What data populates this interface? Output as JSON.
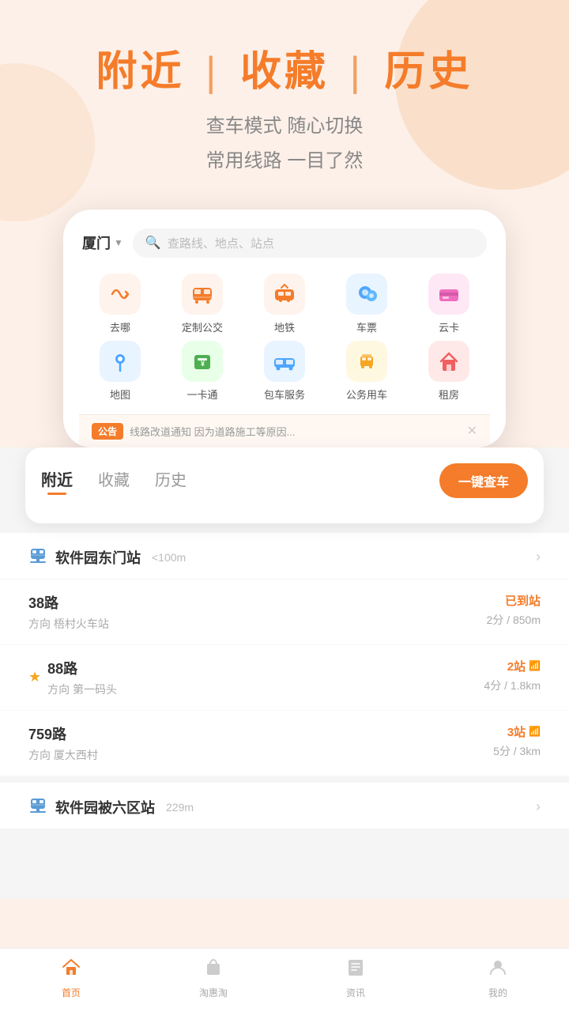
{
  "hero": {
    "title_part1": "附近",
    "title_divider": "|",
    "title_part2": "收藏",
    "title_divider2": "|",
    "title_part3": "历史",
    "subtitle_line1": "查车模式 随心切换",
    "subtitle_line2": "常用线路 一目了然"
  },
  "app": {
    "city": "厦门",
    "search_placeholder": "查路线、地点、站点"
  },
  "icon_grid": {
    "row1": [
      {
        "label": "去哪",
        "icon": "🔄",
        "bg": "#fff3ed",
        "color": "#f47c2a"
      },
      {
        "label": "定制公交",
        "icon": "🚌",
        "bg": "#fff3ed",
        "color": "#f47c2a"
      },
      {
        "label": "地铁",
        "icon": "🚇",
        "bg": "#fff3ed",
        "color": "#f47c2a"
      },
      {
        "label": "车票",
        "icon": "👥",
        "bg": "#e8f4ff",
        "color": "#4da6ff"
      },
      {
        "label": "云卡",
        "icon": "💳",
        "bg": "#ffe8f5",
        "color": "#f06cbe"
      }
    ],
    "row2": [
      {
        "label": "地图",
        "icon": "📍",
        "bg": "#e8f4ff",
        "color": "#4da6ff"
      },
      {
        "label": "一卡通",
        "icon": "💴",
        "bg": "#e8ffe8",
        "color": "#4caf50"
      },
      {
        "label": "包车服务",
        "icon": "🚙",
        "bg": "#e8f4ff",
        "color": "#4da6ff"
      },
      {
        "label": "公务用车",
        "icon": "🧳",
        "bg": "#fff8e0",
        "color": "#f5a623"
      },
      {
        "label": "租房",
        "icon": "🏠",
        "bg": "#ffe8e8",
        "color": "#f06060"
      }
    ]
  },
  "notice": {
    "tag": "公告",
    "text": "线路改道通知 因为道路施工等原因..."
  },
  "tabs": {
    "items": [
      "附近",
      "收藏",
      "历史"
    ],
    "active": 0,
    "action_btn": "一键查车"
  },
  "stations": [
    {
      "name": "软件园东门站",
      "distance": "<100m",
      "buses": [
        {
          "number": "38路",
          "direction": "方向 梧村火车站",
          "status": "已到站",
          "status_type": "arrived",
          "time_info": "2分 / 850m",
          "starred": false
        },
        {
          "number": "88路",
          "direction": "方向 第一码头",
          "status": "2站",
          "status_type": "stops",
          "time_info": "4分 / 1.8km",
          "starred": true,
          "has_wifi": true
        },
        {
          "number": "759路",
          "direction": "方向 厦大西村",
          "status": "3站",
          "status_type": "stops",
          "time_info": "5分 / 3km",
          "starred": false,
          "has_wifi": true
        }
      ]
    },
    {
      "name": "软件园被六区站",
      "distance": "229m",
      "buses": []
    }
  ],
  "bottom_nav": [
    {
      "label": "首页",
      "icon": "🏠",
      "active": true
    },
    {
      "label": "淘惠淘",
      "icon": "🛍️",
      "active": false
    },
    {
      "label": "资讯",
      "icon": "📋",
      "active": false
    },
    {
      "label": "我的",
      "icon": "😊",
      "active": false
    }
  ]
}
